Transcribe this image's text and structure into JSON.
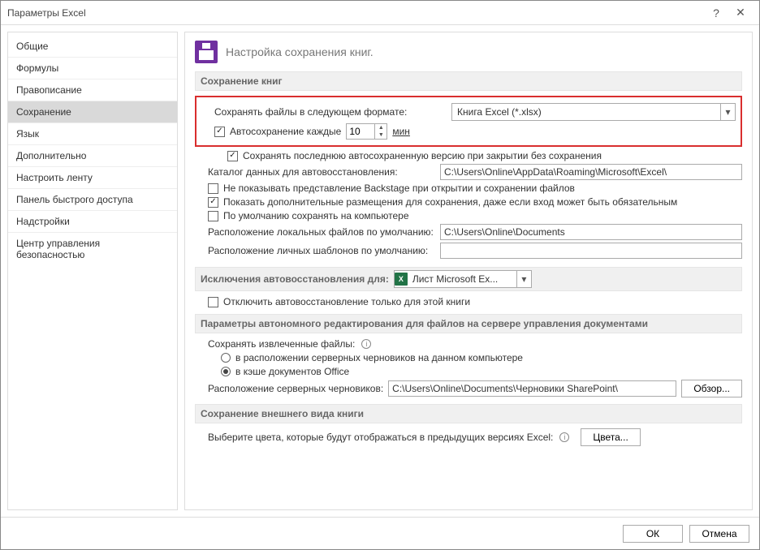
{
  "window": {
    "title": "Параметры Excel",
    "help": "?",
    "close": "✕"
  },
  "sidebar": {
    "items": [
      "Общие",
      "Формулы",
      "Правописание",
      "Сохранение",
      "Язык",
      "Дополнительно",
      "Настроить ленту",
      "Панель быстрого доступа",
      "Надстройки",
      "Центр управления безопасностью"
    ],
    "selected_index": 3
  },
  "header": {
    "text": "Настройка сохранения книг."
  },
  "sections": {
    "save_books": "Сохранение книг",
    "autorecover_except": "Исключения автовосстановления для:",
    "offline_edit": "Параметры автономного редактирования для файлов на сервере управления документами",
    "appearance": "Сохранение внешнего вида книги"
  },
  "save": {
    "format_label": "Сохранять файлы в следующем формате:",
    "format_value": "Книга Excel (*.xlsx)",
    "autosave_label": "Автосохранение каждые",
    "autosave_value": "10",
    "autosave_unit": "мин",
    "keep_last_label": "Сохранять последнюю автосохраненную версию при закрытии без сохранения",
    "catalog_label": "Каталог данных для автовосстановления:",
    "catalog_value": "C:\\Users\\Online\\AppData\\Roaming\\Microsoft\\Excel\\",
    "no_backstage_label": "Не показывать представление Backstage при открытии и сохранении файлов",
    "show_additional_label": "Показать дополнительные размещения для сохранения, даже если вход может быть обязательным",
    "default_pc_label": "По умолчанию сохранять на компьютере",
    "local_path_label": "Расположение локальных файлов по умолчанию:",
    "local_path_value": "C:\\Users\\Online\\Documents",
    "templates_label": "Расположение личных шаблонов по умолчанию:",
    "templates_value": ""
  },
  "except": {
    "book_name": "Лист Microsoft Ex...",
    "disable_label": "Отключить автовосстановление только для этой книги"
  },
  "offline": {
    "save_extracted_label": "Сохранять извлеченные файлы:",
    "opt1": "в расположении серверных черновиков на данном компьютере",
    "opt2": "в кэше документов Office",
    "drafts_label": "Расположение серверных черновиков:",
    "drafts_value": "C:\\Users\\Online\\Documents\\Черновики SharePoint\\",
    "browse": "Обзор..."
  },
  "appearance": {
    "text": "Выберите цвета, которые будут отображаться в предыдущих версиях Excel:",
    "colors_btn": "Цвета..."
  },
  "footer": {
    "ok": "ОК",
    "cancel": "Отмена"
  }
}
